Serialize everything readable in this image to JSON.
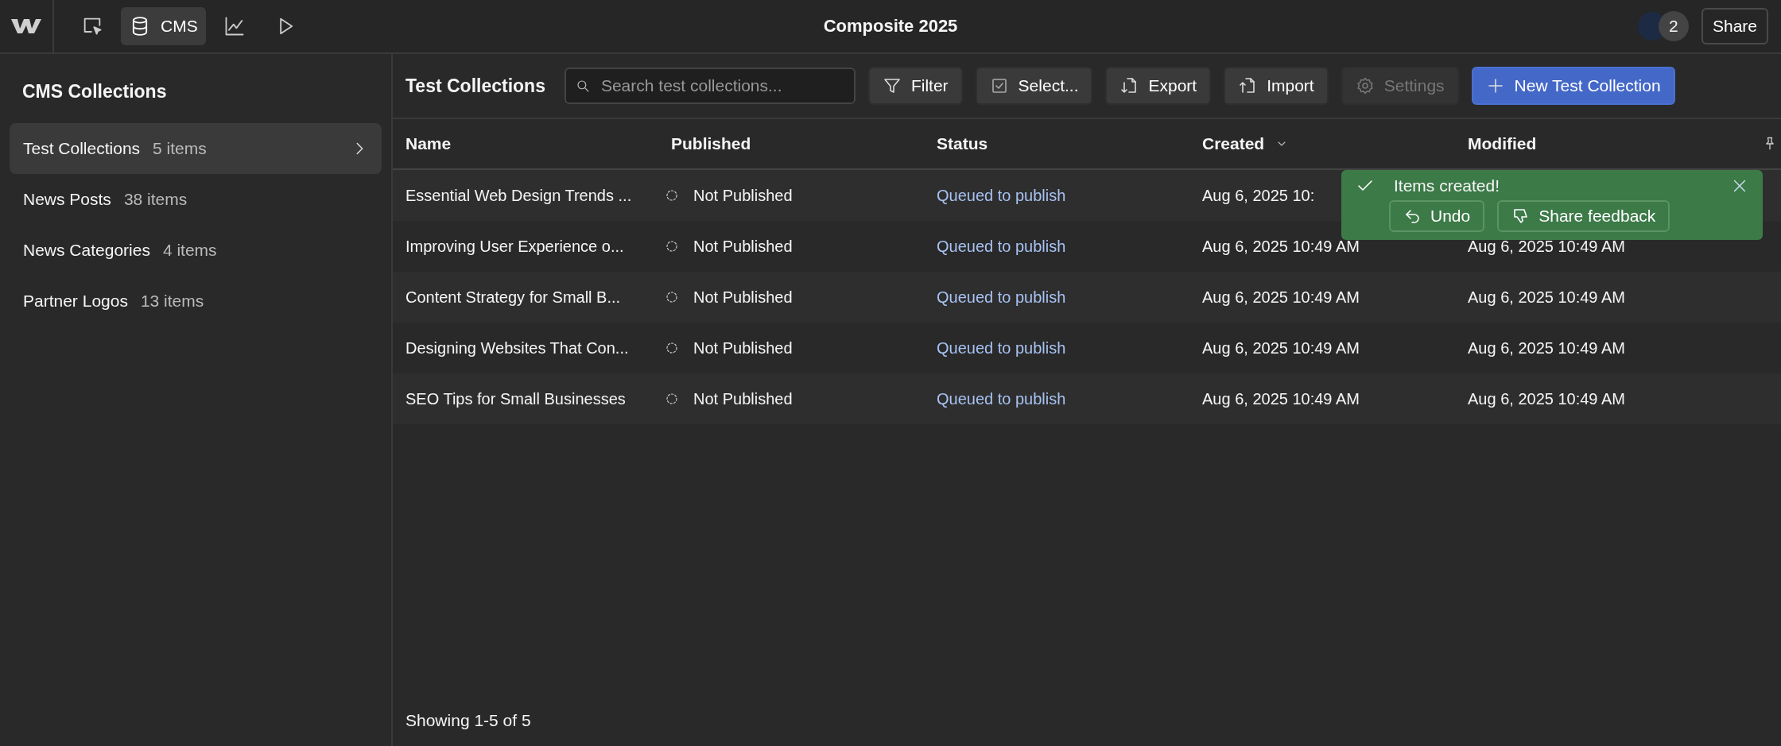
{
  "top_bar": {
    "tools": [
      {
        "kind": "designer",
        "selected": false
      },
      {
        "kind": "cms",
        "label": "CMS",
        "selected": true
      },
      {
        "kind": "insights",
        "selected": false
      },
      {
        "kind": "preview",
        "selected": false
      }
    ],
    "title": "Composite 2025",
    "collaborator_count": "2",
    "share_button": "Share"
  },
  "sidebar": {
    "title": "CMS Collections",
    "items": [
      {
        "label": "Test Collections",
        "count": "5 items",
        "selected": true
      },
      {
        "label": "News Posts",
        "count": "38 items",
        "selected": false
      },
      {
        "label": "News Categories",
        "count": "4 items",
        "selected": false
      },
      {
        "label": "Partner Logos",
        "count": "13 items",
        "selected": false
      }
    ]
  },
  "toolbar": {
    "title": "Test Collections",
    "search": {
      "placeholder": "Search test collections..."
    },
    "buttons": [
      {
        "kind": "filter",
        "label": "Filter",
        "disabled": false
      },
      {
        "kind": "select",
        "label": "Select...",
        "disabled": false
      },
      {
        "kind": "export",
        "label": "Export",
        "disabled": false
      },
      {
        "kind": "import",
        "label": "Import",
        "disabled": false
      },
      {
        "kind": "settings",
        "label": "Settings",
        "disabled": true
      },
      {
        "kind": "new",
        "label": "New Test Collection",
        "disabled": false
      }
    ]
  },
  "table": {
    "columns": [
      {
        "label": "Name",
        "sorted": false
      },
      {
        "label": "Published",
        "sorted": false
      },
      {
        "label": "Status",
        "sorted": false
      },
      {
        "label": "Created",
        "sorted": true
      },
      {
        "label": "Modified",
        "sorted": false
      }
    ],
    "rows": [
      {
        "name": "Essential Web Design Trends ...",
        "published": "Not Published",
        "status": "Queued to publish",
        "created": "Aug 6, 2025 10:"
      },
      {
        "name": "Improving User Experience o...",
        "published": "Not Published",
        "status": "Queued to publish",
        "created": "Aug 6, 2025 10:49 AM",
        "modified": "Aug 6, 2025 10:49 AM"
      },
      {
        "name": "Content Strategy for Small B...",
        "published": "Not Published",
        "status": "Queued to publish",
        "created": "Aug 6, 2025 10:49 AM",
        "modified": "Aug 6, 2025 10:49 AM"
      },
      {
        "name": "Designing Websites That Con...",
        "published": "Not Published",
        "status": "Queued to publish",
        "created": "Aug 6, 2025 10:49 AM",
        "modified": "Aug 6, 2025 10:49 AM"
      },
      {
        "name": "SEO Tips for Small Businesses",
        "published": "Not Published",
        "status": "Queued to publish",
        "created": "Aug 6, 2025 10:49 AM",
        "modified": "Aug 6, 2025 10:49 AM"
      }
    ],
    "footer": "Showing 1-5 of 5"
  },
  "toast": {
    "message": "Items created!",
    "buttons": [
      {
        "kind": "undo",
        "label": "Undo"
      },
      {
        "kind": "feedback",
        "label": "Share feedback"
      }
    ]
  }
}
